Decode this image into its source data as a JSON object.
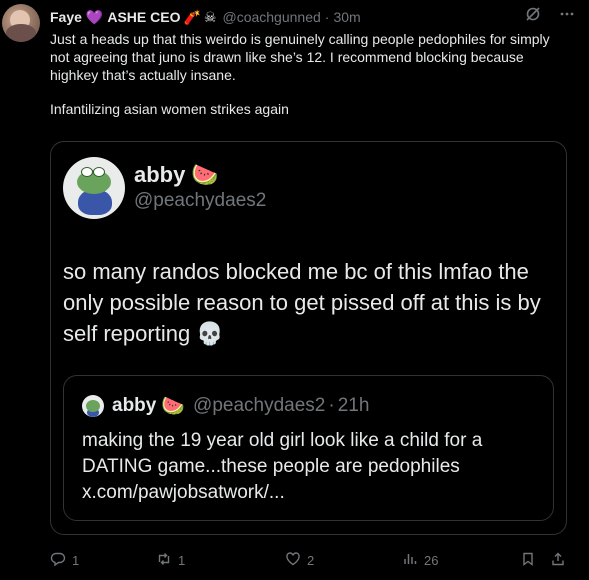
{
  "tweet": {
    "author_name": "Faye",
    "author_badges": [
      "💜",
      "ASHE CEO",
      "🧨",
      "☠"
    ],
    "handle": "@coachgunned",
    "separator": "·",
    "time": "30m",
    "text_p1": "Just a heads up that this weirdo is genuinely calling people pedophiles for simply not agreeing that juno is drawn like she’s 12. I recommend blocking because highkey that’s actually insane.",
    "text_p2": "Infantilizing asian women strikes again"
  },
  "quote": {
    "name": "abby",
    "emoji": "🍉",
    "handle": "@peachydaes2",
    "text": "so many randos blocked me bc of this lmfao the only possible reason to get pissed off at this is by self reporting 💀"
  },
  "nested_quote": {
    "name": "abby",
    "emoji": "🍉",
    "handle": "@peachydaes2",
    "separator": "·",
    "time": "21h",
    "text": "making the 19 year old girl look like a child for a DATING game...these people are pedophiles x.com/pawjobsatwork/..."
  },
  "actions": {
    "reply_count": "1",
    "retweet_count": "1",
    "like_count": "2",
    "views_count": "26"
  },
  "colors": {
    "background": "#000000",
    "text": "#e7e9ea",
    "muted": "#71767b",
    "border": "#2f3336"
  }
}
